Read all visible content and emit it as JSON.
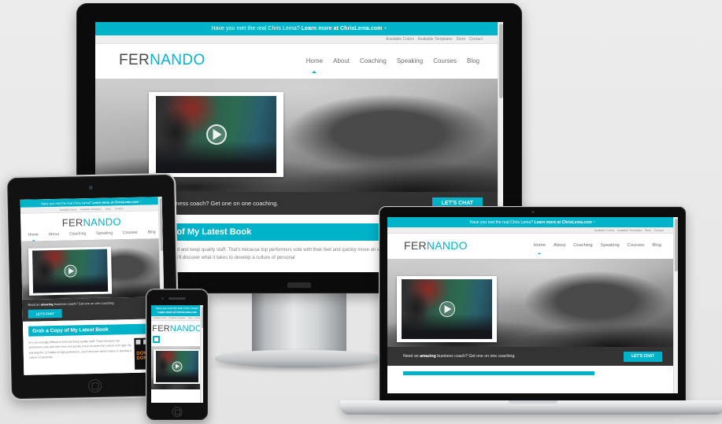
{
  "showcase": {
    "background_color": "#e9e9e9",
    "devices": [
      "desktop-imac",
      "tablet",
      "phone",
      "laptop-macbook"
    ]
  },
  "site": {
    "brand": {
      "accent_color": "#00b3c8",
      "dark_color": "#333333",
      "logo_part1": "FER",
      "logo_part2": "NANDO"
    },
    "promo": {
      "text_lead": "Have you met the real Chris Lema?",
      "text_link": "Learn more at ChrisLema.com",
      "close": "×"
    },
    "util_nav": [
      "Available Colors",
      "Available Templates",
      "Store",
      "Contact"
    ],
    "main_nav": [
      {
        "label": "Home",
        "active": true
      },
      {
        "label": "About",
        "active": false
      },
      {
        "label": "Coaching",
        "active": false
      },
      {
        "label": "Speaking",
        "active": false
      },
      {
        "label": "Courses",
        "active": false
      },
      {
        "label": "Blog",
        "active": false
      }
    ],
    "hero": {
      "play_icon": "play-icon",
      "video_caption": ""
    },
    "cta": {
      "text_pre": "Need an ",
      "text_bold": "amazing",
      "text_post": " business coach? Get one on one coaching.",
      "button": "LET'S CHAT"
    },
    "book": {
      "heading": "Grab a Copy of My Latest Book",
      "paragraph": "It is increasingly difficult to find and keep quality staff. That's because top performers vote with their feet and quickly move on when the culture isn't right. By learning the 12 habits of high performers, you'll discover what it takes to develop a culture of personal",
      "cover_title": "DONE DONE"
    },
    "mobile": {
      "menu_icon": "hamburger-icon"
    }
  }
}
